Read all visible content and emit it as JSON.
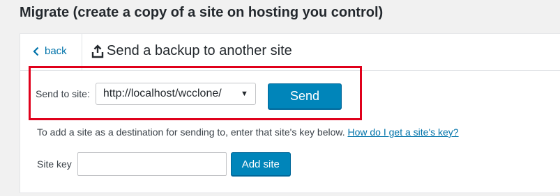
{
  "page": {
    "title": "Migrate (create a copy of a site on hosting you control)"
  },
  "header": {
    "back_label": "back",
    "title": "Send a backup to another site"
  },
  "send": {
    "label": "Send to site:",
    "selected_site": "http://localhost/wcclone/",
    "button_label": "Send"
  },
  "help": {
    "text": "To add a site as a destination for sending to, enter that site's key below.",
    "link_text": "How do I get a site's key?"
  },
  "site_key": {
    "label": "Site key",
    "value": "",
    "button_label": "Add site"
  },
  "colors": {
    "accent": "#0085ba",
    "link": "#0073aa",
    "highlight": "#e0001b"
  },
  "icons": {
    "back": "chevron-left-icon",
    "upload": "upload-icon",
    "dropdown": "caret-down-icon"
  }
}
